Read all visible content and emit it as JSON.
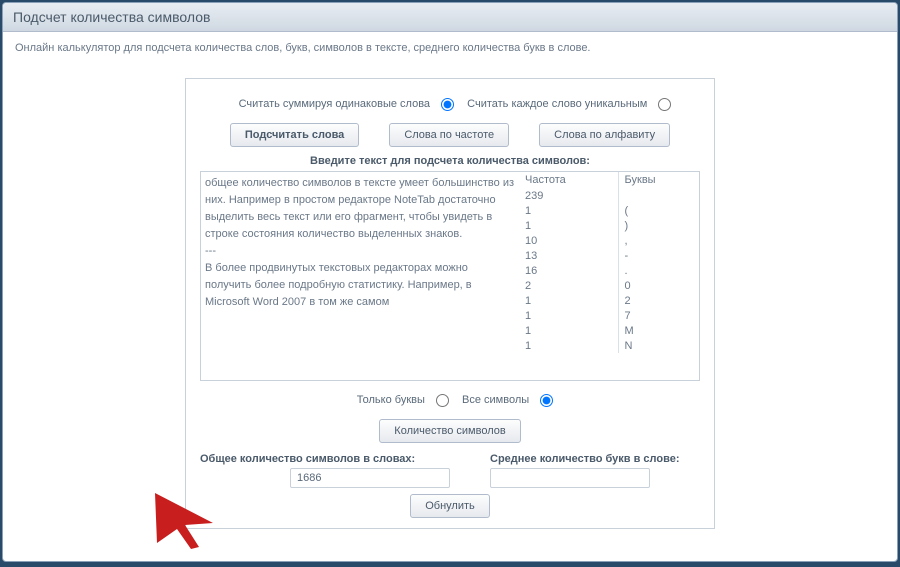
{
  "title": "Подсчет количества символов",
  "subtitle": "Онлайн калькулятор для подсчета количества слов, букв, символов в тексте, среднего количества букв в слове.",
  "radios": {
    "sum_same_label": "Считать суммируя одинаковые слова",
    "each_unique_label": "Считать каждое слово уникальным"
  },
  "buttons": {
    "count_words": "Подсчитать слова",
    "words_by_freq": "Слова по частоте",
    "words_by_alpha": "Слова по алфавиту",
    "char_count": "Количество символов",
    "reset": "Обнулить"
  },
  "section_label": "Введите текст для подсчета количества символов:",
  "textarea_value": "общее количество символов в тексте умеет большинство из них. Например в простом редакторе NoteTab достаточно выделить весь текст или его фрагмент, чтобы увидеть в строке состояния количество выделенных знаков.\n---\nВ более продвинутых текстовых редакторах можно получить более подробную статистику. Например, в Microsoft Word 2007 в том же самом",
  "freq_headers": {
    "count": "Частота",
    "letter": "Буквы"
  },
  "freq_rows": [
    {
      "count": "239",
      "letter": ""
    },
    {
      "count": "1",
      "letter": "("
    },
    {
      "count": "1",
      "letter": ")"
    },
    {
      "count": "10",
      "letter": ","
    },
    {
      "count": "13",
      "letter": "-"
    },
    {
      "count": "16",
      "letter": "."
    },
    {
      "count": "2",
      "letter": "0"
    },
    {
      "count": "1",
      "letter": "2"
    },
    {
      "count": "1",
      "letter": "7"
    },
    {
      "count": "1",
      "letter": "M"
    },
    {
      "count": "1",
      "letter": "N"
    }
  ],
  "filter": {
    "letters_only": "Только буквы",
    "all_chars": "Все символы"
  },
  "totals": {
    "total_label": "Общее количество символов в словах:",
    "total_value": "1686",
    "avg_label": "Среднее количество букв в слове:",
    "avg_value": ""
  }
}
